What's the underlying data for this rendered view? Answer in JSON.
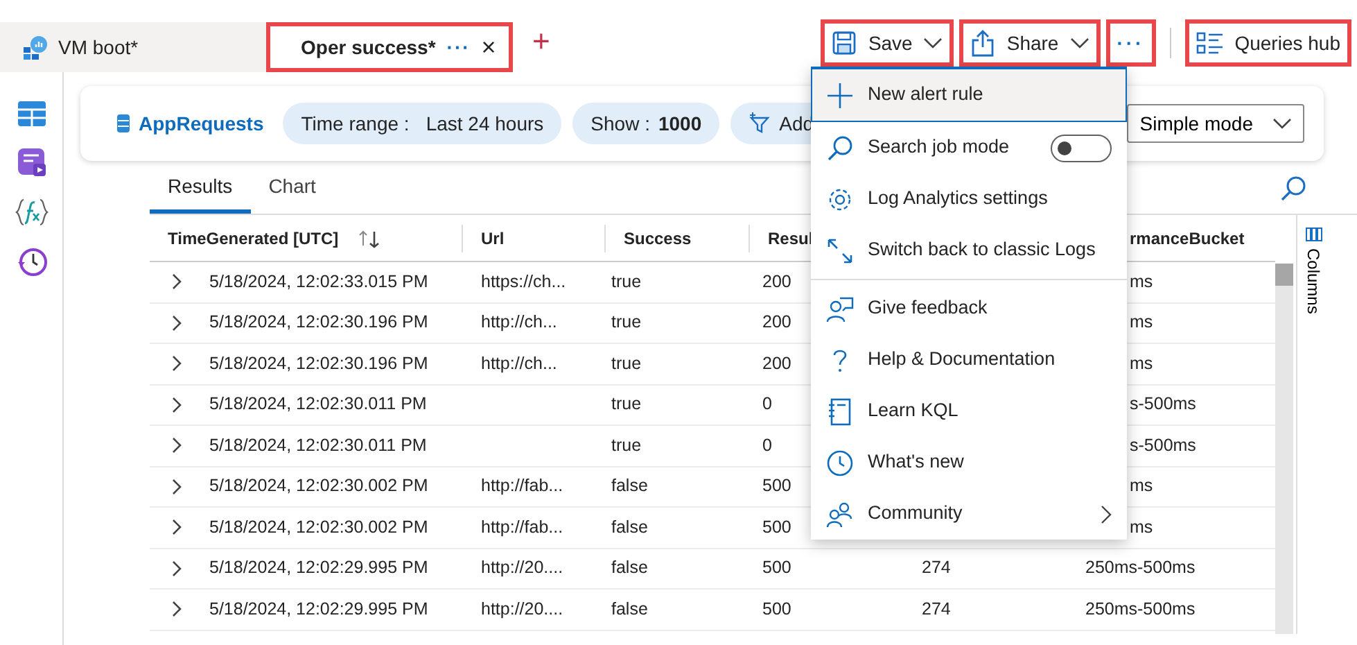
{
  "doc_tabs": [
    {
      "label": "VM boot*",
      "selected": false,
      "highlighted": false
    },
    {
      "label": "Oper success*",
      "selected": true,
      "highlighted": true,
      "more": "···",
      "close": "×"
    }
  ],
  "new_tab": "+",
  "toolbar": [
    {
      "kind": "save",
      "label": "Save",
      "dropdown": true,
      "highlighted": true
    },
    {
      "kind": "share",
      "label": "Share",
      "dropdown": true,
      "highlighted": true
    },
    {
      "kind": "more",
      "label": "···",
      "dropdown": false,
      "highlighted": true
    },
    {
      "kind": "queries",
      "label": "Queries hub",
      "dropdown": false,
      "highlighted": true
    }
  ],
  "query_bar": {
    "table": "AppRequests",
    "time_range": {
      "label": "Time range :",
      "value": "Last 24 hours"
    },
    "show": {
      "label": "Show :",
      "value": "1000"
    },
    "add": "Add",
    "mode": "Simple mode"
  },
  "result_tabs": [
    {
      "label": "Results",
      "selected": true
    },
    {
      "label": "Chart",
      "selected": false
    }
  ],
  "table": {
    "header": {
      "time": "TimeGenerated [UTC]",
      "url": "Url",
      "success": "Success",
      "result": "Resul",
      "column_6": "rmanceBucket"
    },
    "rows": [
      {
        "time": "5/18/2024, 12:02:33.015 PM",
        "url": "https://ch...",
        "success": "true",
        "result": "200",
        "column_6": "ms"
      },
      {
        "time": "5/18/2024, 12:02:30.196 PM",
        "url": "http://ch...",
        "success": "true",
        "result": "200",
        "column_6": "ms"
      },
      {
        "time": "5/18/2024, 12:02:30.196 PM",
        "url": "http://ch...",
        "success": "true",
        "result": "200",
        "column_6": "ms"
      },
      {
        "time": "5/18/2024, 12:02:30.011 PM",
        "success": "true",
        "result": "0",
        "column_6": "s-500ms"
      },
      {
        "time": "5/18/2024, 12:02:30.011 PM",
        "success": "true",
        "result": "0",
        "column_6": "s-500ms"
      },
      {
        "time": "5/18/2024, 12:02:30.002 PM",
        "url": "http://fab...",
        "success": "false",
        "result": "500",
        "column_6": "ms"
      },
      {
        "time": "5/18/2024, 12:02:30.002 PM",
        "url": "http://fab...",
        "success": "false",
        "result": "500",
        "column_6": "ms"
      },
      {
        "time": "5/18/2024, 12:02:29.995 PM",
        "url": "http://20....",
        "success": "false",
        "result": "500",
        "column_5": "274",
        "column_6": "250ms-500ms"
      },
      {
        "time": "5/18/2024, 12:02:29.995 PM",
        "url": "http://20....",
        "success": "false",
        "result": "500",
        "column_5": "274",
        "column_6": "250ms-500ms"
      }
    ]
  },
  "columns_panel": "Columns",
  "menu": {
    "items": [
      {
        "kind": "action",
        "label": "New alert rule",
        "selected": true
      },
      {
        "kind": "toggle",
        "label": "Search job mode",
        "on": false,
        "selected": false
      },
      {
        "kind": "action",
        "label": "Log Analytics settings",
        "selected": false
      },
      {
        "kind": "action",
        "label": "Switch back to classic Logs",
        "selected": false
      },
      {
        "kind": "divider"
      },
      {
        "kind": "action",
        "label": "Give feedback",
        "selected": false
      },
      {
        "kind": "action",
        "label": "Help & Documentation",
        "selected": false
      },
      {
        "kind": "action",
        "label": "Learn KQL",
        "selected": false
      },
      {
        "kind": "action",
        "label": "What's new",
        "selected": false
      },
      {
        "kind": "submenu",
        "label": "Community",
        "selected": false
      }
    ]
  }
}
